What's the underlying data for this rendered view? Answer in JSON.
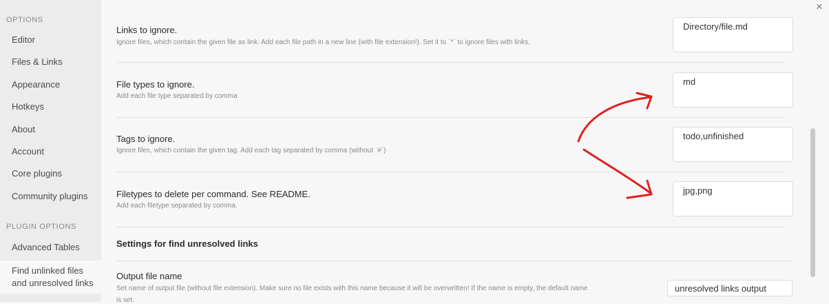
{
  "sidebar": {
    "options_header": "OPTIONS",
    "items": [
      {
        "label": "Editor"
      },
      {
        "label": "Files & Links"
      },
      {
        "label": "Appearance"
      },
      {
        "label": "Hotkeys"
      },
      {
        "label": "About"
      },
      {
        "label": "Account"
      },
      {
        "label": "Core plugins"
      },
      {
        "label": "Community plugins"
      }
    ],
    "plugin_options_header": "PLUGIN OPTIONS",
    "plugin_items": [
      {
        "label": "Advanced Tables"
      },
      {
        "label_line1": "Find unlinked files",
        "label_line2": "and unresolved links"
      }
    ]
  },
  "settings": [
    {
      "name": "Links to ignore.",
      "description": "Ignore files, which contain the given file as link. Add each file path in a new line (with file extension!). Set it to `*` to ignore files with links.",
      "value": "Directory/file.md"
    },
    {
      "name": "File types to ignore.",
      "description": "Add each file type separated by comma",
      "value": "md"
    },
    {
      "name": "Tags to ignore.",
      "description": "Ignore files, which contain the given tag. Add each tag separated by comma (without `#`)",
      "value": "todo,unfinished"
    },
    {
      "name": "Filetypes to delete per command. See README.",
      "description": "Add each filetype separated by comma.",
      "value": "jpg,png"
    }
  ],
  "unresolved_section": {
    "heading": "Settings for find unresolved links",
    "output_name": "Output file name",
    "output_description": "Set name of output file (without file extension). Make sure no file exists with this name because it will be overwritten! If the name is empty, the default name",
    "output_description_cont": "is set.",
    "output_value": "unresolved links output"
  },
  "window": {
    "close_glyph": "×"
  },
  "annotation": {
    "color": "#e02020"
  }
}
